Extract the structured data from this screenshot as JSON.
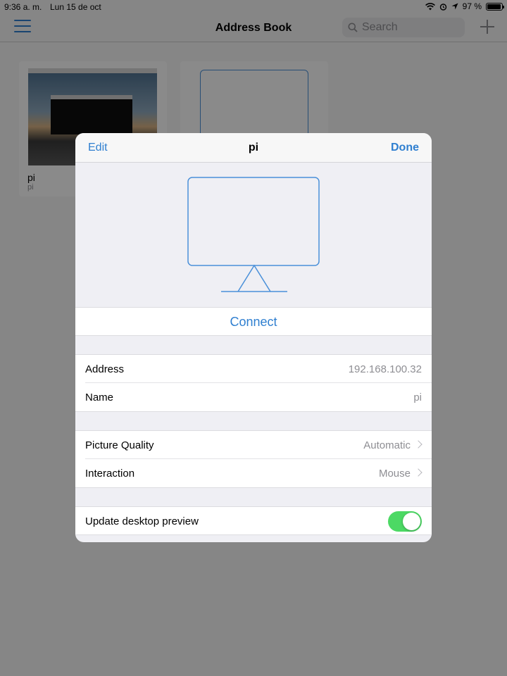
{
  "status_bar": {
    "time": "9:36 a. m.",
    "date": "Lun 15 de oct",
    "battery": "97 %",
    "battery_level": 0.97
  },
  "navbar": {
    "title": "Address Book",
    "search_placeholder": "Search"
  },
  "cards": [
    {
      "name": "pi",
      "subtitle": "pi"
    }
  ],
  "modal": {
    "edit_label": "Edit",
    "title": "pi",
    "done_label": "Done",
    "connect_label": "Connect",
    "address_label": "Address",
    "address_value": "192.168.100.32",
    "name_label": "Name",
    "name_value": "pi",
    "quality_label": "Picture Quality",
    "quality_value": "Automatic",
    "interaction_label": "Interaction",
    "interaction_value": "Mouse",
    "preview_label": "Update desktop preview",
    "preview_enabled": true
  },
  "colors": {
    "accent": "#2f7fd0",
    "toggle_on": "#4cd964",
    "secondary_text": "#8e8e93"
  }
}
